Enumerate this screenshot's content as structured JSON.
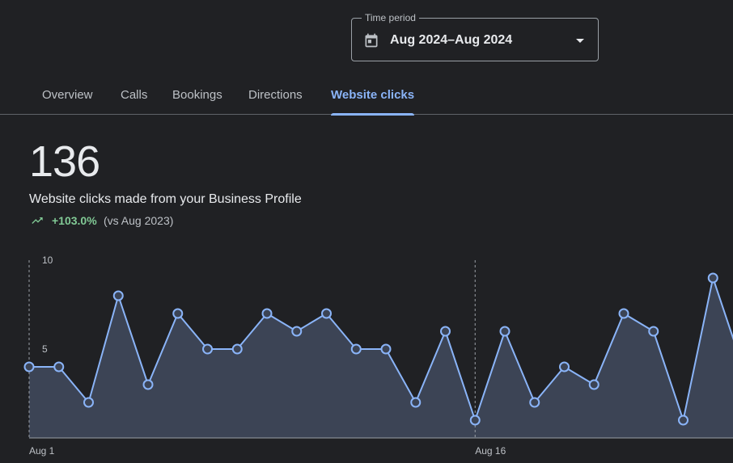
{
  "time_period": {
    "label": "Time period",
    "value": "Aug 2024–Aug 2024"
  },
  "tabs": [
    {
      "label": "Overview",
      "active": false
    },
    {
      "label": "Calls",
      "active": false
    },
    {
      "label": "Bookings",
      "active": false
    },
    {
      "label": "Directions",
      "active": false
    },
    {
      "label": "Website clicks",
      "active": true
    }
  ],
  "metric": {
    "value": "136",
    "description": "Website clicks made from your Business Profile",
    "change": "+103.0%",
    "comparison": "(vs Aug 2023)"
  },
  "colors": {
    "background": "#202124",
    "accent": "#8ab4f8",
    "positive": "#81c995",
    "area_fill": "#3c4455"
  },
  "icons": {
    "calendar": "calendar-icon",
    "dropdown": "arrow-drop-down-icon",
    "trend": "trending-up-icon"
  },
  "chart_data": {
    "type": "area",
    "x": [
      "Aug 1",
      "Aug 2",
      "Aug 3",
      "Aug 4",
      "Aug 5",
      "Aug 6",
      "Aug 7",
      "Aug 8",
      "Aug 9",
      "Aug 10",
      "Aug 11",
      "Aug 12",
      "Aug 13",
      "Aug 14",
      "Aug 15",
      "Aug 16",
      "Aug 17",
      "Aug 18",
      "Aug 19",
      "Aug 20",
      "Aug 21",
      "Aug 22",
      "Aug 23",
      "Aug 24",
      "Aug 25"
    ],
    "values": [
      4,
      4,
      2,
      8,
      3,
      7,
      5,
      5,
      7,
      6,
      7,
      5,
      5,
      2,
      6,
      1,
      6,
      2,
      4,
      3,
      7,
      6,
      1,
      9,
      4
    ],
    "y_ticks": [
      "10",
      "5"
    ],
    "x_tick_labels": [
      "Aug 1",
      "Aug 16"
    ],
    "ylim": [
      0,
      10
    ]
  }
}
